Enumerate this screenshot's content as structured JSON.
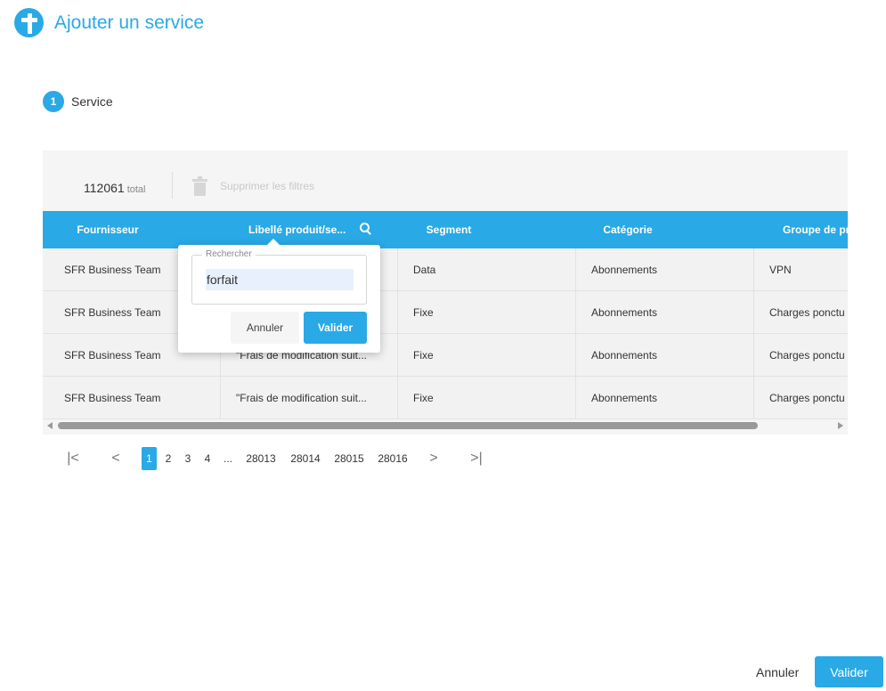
{
  "dialog": {
    "title": "Ajouter un service",
    "icon": "plus-icon"
  },
  "stepper": {
    "number": "1",
    "label": "Service"
  },
  "toolbar": {
    "total": "112061",
    "total_suffix": "total",
    "clear_filters": "Supprimer les filtres",
    "clear_icon": "trash-icon"
  },
  "columns": [
    "Fournisseur",
    "Libellé produit/se...",
    "Segment",
    "Catégorie",
    "Groupe de pr"
  ],
  "rows": [
    [
      "SFR Business Team",
      "",
      "Data",
      "Abonnements",
      "VPN"
    ],
    [
      "SFR Business Team",
      "",
      "Fixe",
      "Abonnements",
      "Charges ponctu"
    ],
    [
      "SFR Business Team",
      "\"Frais de modification suit...",
      "Fixe",
      "Abonnements",
      "Charges ponctu"
    ],
    [
      "SFR Business Team",
      "\"Frais de modification suit...",
      "Fixe",
      "Abonnements",
      "Charges ponctu"
    ]
  ],
  "pagination": {
    "first_icon": "first-page-icon",
    "prev_icon": "prev-page-icon",
    "next_icon": "next-page-icon",
    "last_icon": "last-page-icon",
    "pages": [
      "1",
      "2",
      "3",
      "4",
      "...",
      "28013",
      "28014",
      "28015",
      "28016"
    ],
    "current": "1"
  },
  "filter_popup": {
    "legend": "Rechercher",
    "value": "forfait",
    "cancel": "Annuler",
    "ok": "Valider"
  },
  "footer": {
    "cancel": "Annuler",
    "ok": "Valider"
  },
  "colors": {
    "accent": "#29a9e6",
    "row_bg": "#f2f2f2",
    "panel_bg": "#f5f5f5"
  }
}
